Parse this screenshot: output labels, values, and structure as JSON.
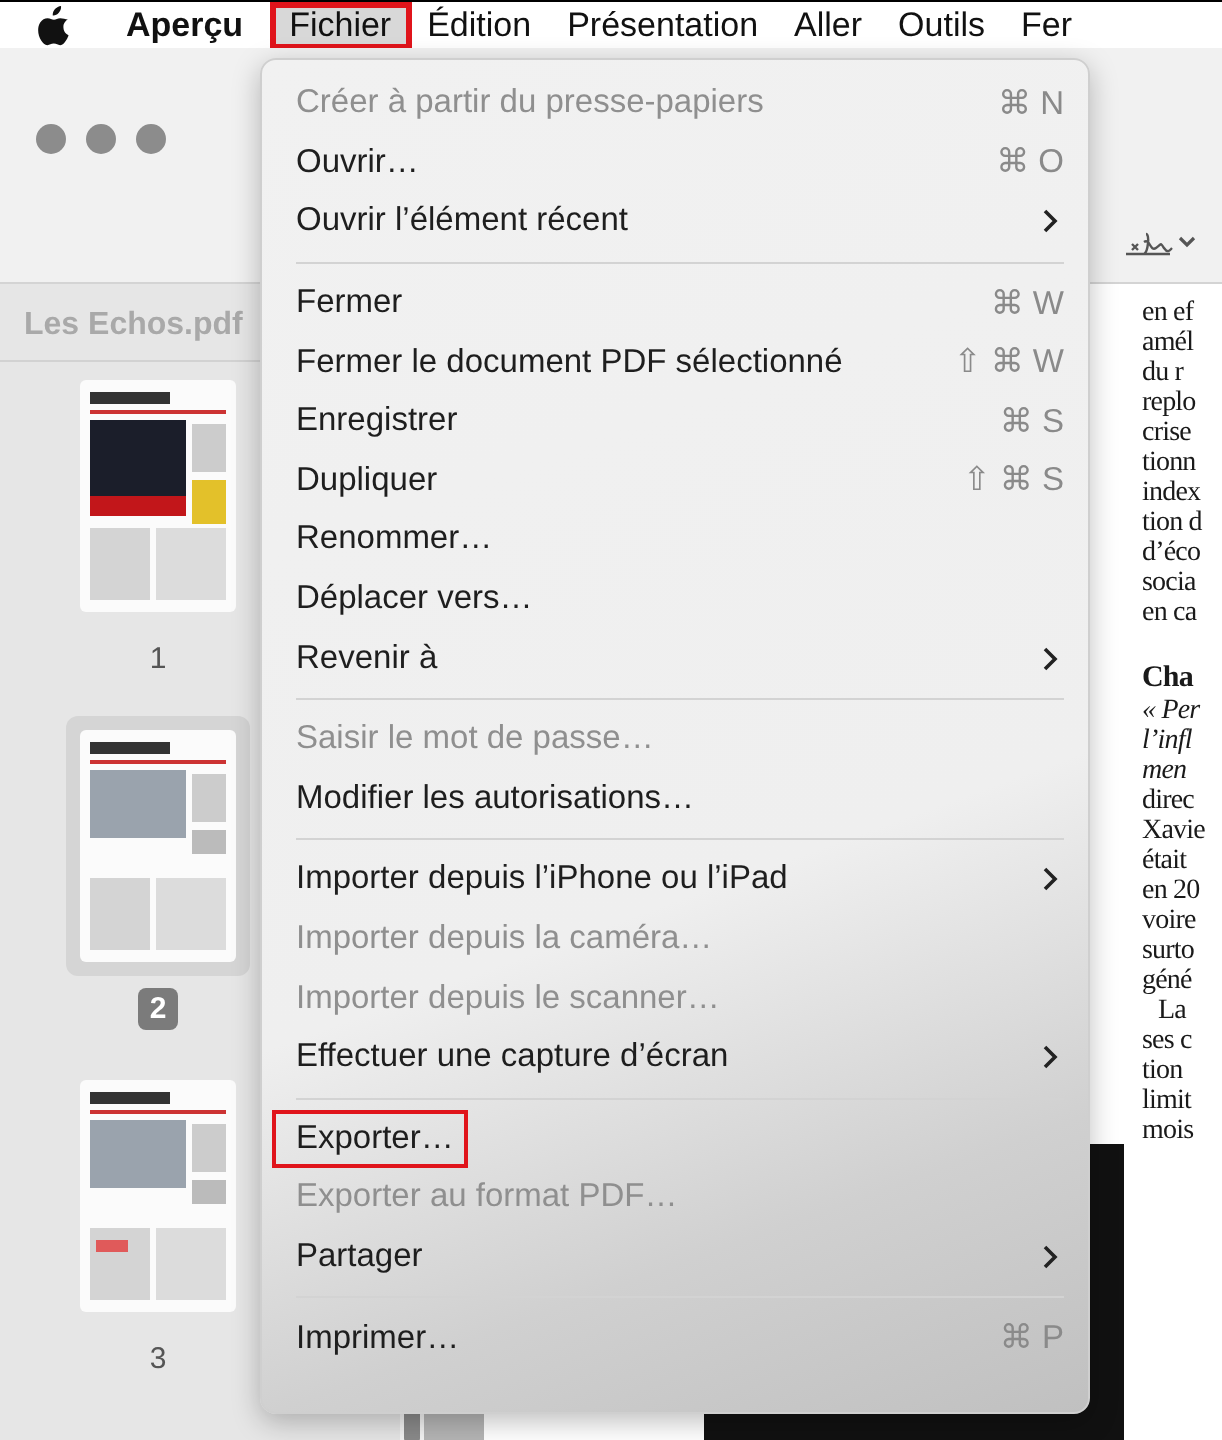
{
  "menubar": [
    {
      "kind": "apple",
      "selected": false,
      "annotated": false
    },
    {
      "kind": "app",
      "label": "Aperçu",
      "selected": false,
      "annotated": false
    },
    {
      "kind": "menu",
      "label": "Fichier",
      "selected": true,
      "annotated": true
    },
    {
      "kind": "menu",
      "label": "Édition",
      "selected": false,
      "annotated": false
    },
    {
      "kind": "menu",
      "label": "Présentation",
      "selected": false,
      "annotated": false
    },
    {
      "kind": "menu",
      "label": "Aller",
      "selected": false,
      "annotated": false
    },
    {
      "kind": "menu",
      "label": "Outils",
      "selected": false,
      "annotated": false
    },
    {
      "kind": "menu",
      "label": "Fer",
      "selected": false,
      "annotated": false
    }
  ],
  "sidebar": {
    "title": "Les Echos.pdf",
    "pages": [
      {
        "label": "1",
        "selected": false,
        "kind": "picture"
      },
      {
        "label": "2",
        "selected": true,
        "kind": "picture"
      },
      {
        "label": "3",
        "selected": false,
        "kind": "picture"
      }
    ]
  },
  "document": {
    "blocks": [
      {
        "kind": "body",
        "lines": [
          "en ef",
          "amél",
          "du r",
          "replo",
          "crise",
          "tionn",
          "index",
          "tion d",
          "d’éco",
          "socia",
          "en ca"
        ]
      },
      {
        "kind": "heading",
        "lines": [
          "Cha"
        ]
      },
      {
        "kind": "italic",
        "lines": [
          "« Per",
          "l’infl",
          "men"
        ]
      },
      {
        "kind": "body",
        "lines": [
          "direc",
          "Xavie",
          "était",
          "en 20",
          "voire",
          "surto",
          "géné"
        ]
      },
      {
        "kind": "indent",
        "lines": [
          "La"
        ]
      },
      {
        "kind": "body",
        "lines": [
          "ses c",
          "tion",
          "limit",
          "mois"
        ]
      }
    ]
  },
  "menu": {
    "items": [
      {
        "kind": "item",
        "label": "Créer à partir du presse-papiers",
        "shortcut": "⌘ N",
        "disabled": true,
        "submenu": false,
        "annotated": false
      },
      {
        "kind": "item",
        "label": "Ouvrir…",
        "shortcut": "⌘ O",
        "disabled": false,
        "submenu": false,
        "annotated": false
      },
      {
        "kind": "item",
        "label": "Ouvrir l’élément récent",
        "disabled": false,
        "submenu": true,
        "annotated": false
      },
      {
        "kind": "separator"
      },
      {
        "kind": "item",
        "label": "Fermer",
        "shortcut": "⌘ W",
        "disabled": false,
        "submenu": false,
        "annotated": false
      },
      {
        "kind": "item",
        "label": "Fermer le document PDF sélectionné",
        "shortcut": "⇧ ⌘ W",
        "disabled": false,
        "submenu": false,
        "annotated": false
      },
      {
        "kind": "item",
        "label": "Enregistrer",
        "shortcut": "⌘ S",
        "disabled": false,
        "submenu": false,
        "annotated": false
      },
      {
        "kind": "item",
        "label": "Dupliquer",
        "shortcut": "⇧ ⌘ S",
        "disabled": false,
        "submenu": false,
        "annotated": false
      },
      {
        "kind": "item",
        "label": "Renommer…",
        "disabled": false,
        "submenu": false,
        "annotated": false
      },
      {
        "kind": "item",
        "label": "Déplacer vers…",
        "disabled": false,
        "submenu": false,
        "annotated": false
      },
      {
        "kind": "item",
        "label": "Revenir à",
        "disabled": false,
        "submenu": true,
        "annotated": false
      },
      {
        "kind": "separator"
      },
      {
        "kind": "item",
        "label": "Saisir le mot de passe…",
        "disabled": true,
        "submenu": false,
        "annotated": false
      },
      {
        "kind": "item",
        "label": "Modifier les autorisations…",
        "disabled": false,
        "submenu": false,
        "annotated": false
      },
      {
        "kind": "separator"
      },
      {
        "kind": "item",
        "label": "Importer depuis l’iPhone ou l’iPad",
        "disabled": false,
        "submenu": true,
        "annotated": false
      },
      {
        "kind": "item",
        "label": "Importer depuis la caméra…",
        "disabled": true,
        "submenu": false,
        "annotated": false
      },
      {
        "kind": "item",
        "label": "Importer depuis le scanner…",
        "disabled": true,
        "submenu": false,
        "annotated": false
      },
      {
        "kind": "item",
        "label": "Effectuer une capture d’écran",
        "disabled": false,
        "submenu": true,
        "annotated": false
      },
      {
        "kind": "separator"
      },
      {
        "kind": "item",
        "label": "Exporter…",
        "disabled": false,
        "submenu": false,
        "annotated": true
      },
      {
        "kind": "item",
        "label": "Exporter au format PDF…",
        "disabled": true,
        "submenu": false,
        "annotated": false
      },
      {
        "kind": "item",
        "label": "Partager",
        "disabled": false,
        "submenu": true,
        "annotated": false
      },
      {
        "kind": "separator"
      },
      {
        "kind": "item",
        "label": "Imprimer…",
        "shortcut": "⌘ P",
        "disabled": false,
        "submenu": false,
        "annotated": false
      }
    ]
  }
}
